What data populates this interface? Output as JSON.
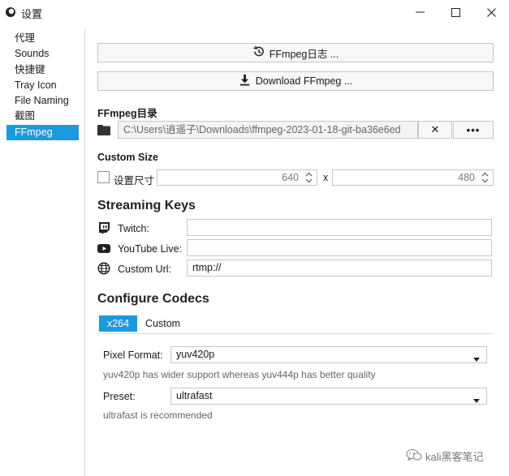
{
  "window": {
    "title": "设置",
    "icons": {
      "app": "app-ring-icon",
      "minimize": "minimize-icon",
      "maximize": "maximize-icon",
      "close": "close-icon"
    }
  },
  "sidebar": {
    "items": [
      {
        "label": "代理",
        "active": false
      },
      {
        "label": "Sounds",
        "active": false
      },
      {
        "label": "快捷键",
        "active": false
      },
      {
        "label": "Tray Icon",
        "active": false
      },
      {
        "label": "File Naming",
        "active": false
      },
      {
        "label": "截图",
        "active": false
      },
      {
        "label": "FFmpeg",
        "active": true
      }
    ]
  },
  "main": {
    "log_button": {
      "label": "FFmpeg日志 ...",
      "icon": "history-icon"
    },
    "download_button": {
      "label": "Download FFmpeg ...",
      "icon": "download-icon"
    },
    "ffmpeg_dir": {
      "heading": "FFmpeg目录",
      "icon": "folder-icon",
      "path": "C:\\Users\\逍遥子\\Downloads\\ffmpeg-2023-01-18-git-ba36e6ed",
      "clear_label": "✕",
      "browse_label": "•••"
    },
    "custom_size": {
      "heading": "Custom Size",
      "checkbox_label": "设置尺寸",
      "checked": false,
      "width": "640",
      "separator": "x",
      "height": "480"
    },
    "streaming_keys": {
      "heading": "Streaming Keys",
      "rows": [
        {
          "icon": "twitch-icon",
          "label": "Twitch:",
          "value": ""
        },
        {
          "icon": "youtube-icon",
          "label": "YouTube Live:",
          "value": ""
        },
        {
          "icon": "globe-icon",
          "label": "Custom Url:",
          "value": "rtmp://"
        }
      ]
    },
    "codecs": {
      "heading": "Configure Codecs",
      "tabs": [
        {
          "label": "x264",
          "active": true
        },
        {
          "label": "Custom",
          "active": false
        }
      ],
      "pixel_format": {
        "label": "Pixel Format:",
        "value": "yuv420p",
        "hint": "yuv420p has wider support whereas yuv444p has better quality"
      },
      "preset": {
        "label": "Preset:",
        "value": "ultrafast",
        "hint": "ultrafast is recommended"
      }
    }
  },
  "watermark": {
    "text": "kali黑客笔记",
    "icon": "wechat-icon"
  },
  "colors": {
    "accent": "#1a9be0",
    "border": "#c6c6c6",
    "button_bg": "#f7f7f7"
  }
}
